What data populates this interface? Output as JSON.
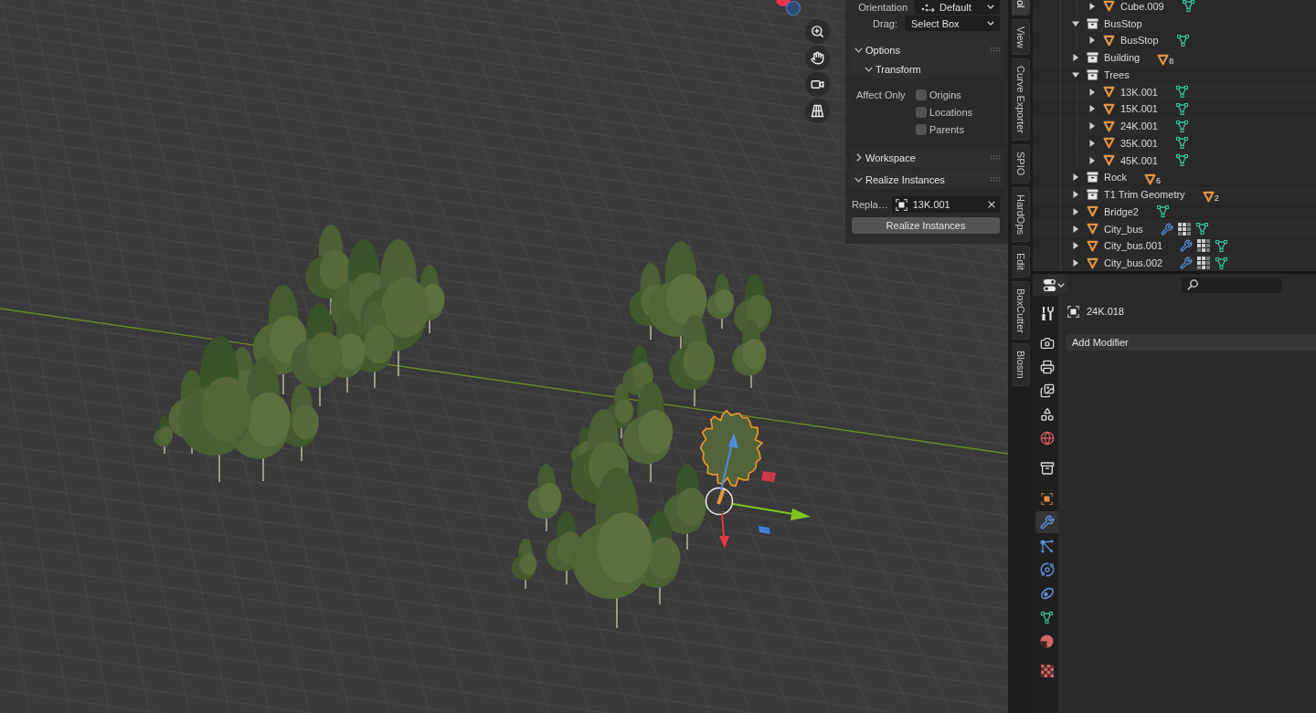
{
  "sidebar": {
    "settings": [
      {
        "kind": "orientation",
        "label": "Orientation",
        "value": "Default"
      },
      {
        "kind": "select",
        "label": "Drag:",
        "value": "Select Box"
      }
    ],
    "panels": [
      {
        "kind": "options",
        "title": "Options",
        "expanded": true,
        "subpanel": {
          "title": "Transform",
          "expanded": true,
          "label": "Affect Only",
          "options": [
            {
              "label": "Origins",
              "checked": false
            },
            {
              "label": "Locations",
              "checked": false
            },
            {
              "label": "Parents",
              "checked": false
            }
          ]
        }
      },
      {
        "kind": "workspace",
        "title": "Workspace",
        "expanded": false
      },
      {
        "kind": "realize",
        "title": "Realize Instances",
        "expanded": true,
        "field": {
          "label": "Repla…",
          "value": "13K.001"
        },
        "button": "Realize Instances"
      }
    ],
    "tabs": [
      {
        "label": "ol",
        "selected": true
      },
      {
        "label": "View",
        "selected": false
      },
      {
        "label": "Curve Exporter",
        "selected": false
      },
      {
        "label": "SPIO",
        "selected": false
      },
      {
        "label": "HardOps",
        "selected": false
      },
      {
        "label": "Edit",
        "selected": false
      },
      {
        "label": "BoxCutter",
        "selected": false
      },
      {
        "label": "Blosm",
        "selected": false
      }
    ]
  },
  "outliner": {
    "items": [
      {
        "children": [
          {
            "kind": "object",
            "name": "Cube.009",
            "expanded": false,
            "modifiers": false
          }
        ]
      },
      {
        "kind": "collection",
        "name": "BusStop",
        "expanded": true,
        "children": [
          {
            "kind": "object",
            "name": "BusStop",
            "expanded": false,
            "modifiers": false
          }
        ]
      },
      {
        "kind": "collection",
        "name": "Building",
        "expanded": false,
        "count": "8"
      },
      {
        "kind": "collection",
        "name": "Trees",
        "expanded": true,
        "children": [
          {
            "kind": "object",
            "name": "13K.001",
            "expanded": false,
            "modifiers": false
          },
          {
            "kind": "object",
            "name": "15K.001",
            "expanded": false,
            "modifiers": false
          },
          {
            "kind": "object",
            "name": "24K.001",
            "expanded": false,
            "modifiers": false
          },
          {
            "kind": "object",
            "name": "35K.001",
            "expanded": false,
            "modifiers": false
          },
          {
            "kind": "object",
            "name": "45K.001",
            "expanded": false,
            "modifiers": false
          }
        ]
      },
      {
        "kind": "collection",
        "name": "Rock",
        "expanded": false,
        "count": "6"
      },
      {
        "kind": "collection",
        "name": "T1 Trim Geometry",
        "expanded": false,
        "count": "2"
      },
      {
        "kind": "object",
        "name": "Bridge2",
        "expanded": false,
        "modifiers": false
      },
      {
        "kind": "object",
        "name": "City_bus",
        "expanded": false,
        "modifiers": true
      },
      {
        "kind": "object",
        "name": "City_bus.001",
        "expanded": false,
        "modifiers": true
      },
      {
        "kind": "object",
        "name": "City_bus.002",
        "expanded": false,
        "modifiers": true
      }
    ]
  },
  "properties": {
    "tab_groups": [
      [
        {
          "kind": "tool",
          "selected": false
        }
      ],
      [
        {
          "kind": "render",
          "selected": false
        },
        {
          "kind": "output",
          "selected": false
        },
        {
          "kind": "view_layer",
          "selected": false
        },
        {
          "kind": "scene",
          "selected": false
        },
        {
          "kind": "world",
          "selected": false
        }
      ],
      [
        {
          "kind": "collection",
          "selected": false
        }
      ],
      [
        {
          "kind": "object",
          "selected": false
        },
        {
          "kind": "modifiers",
          "selected": true
        },
        {
          "kind": "particles",
          "selected": false
        },
        {
          "kind": "physics",
          "selected": false
        },
        {
          "kind": "constraints",
          "selected": false
        },
        {
          "kind": "data",
          "selected": false
        },
        {
          "kind": "material",
          "selected": false
        }
      ],
      [
        {
          "kind": "texture",
          "selected": false
        }
      ]
    ],
    "object_name": "24K.018",
    "add_modifier": "Add Modifier"
  }
}
